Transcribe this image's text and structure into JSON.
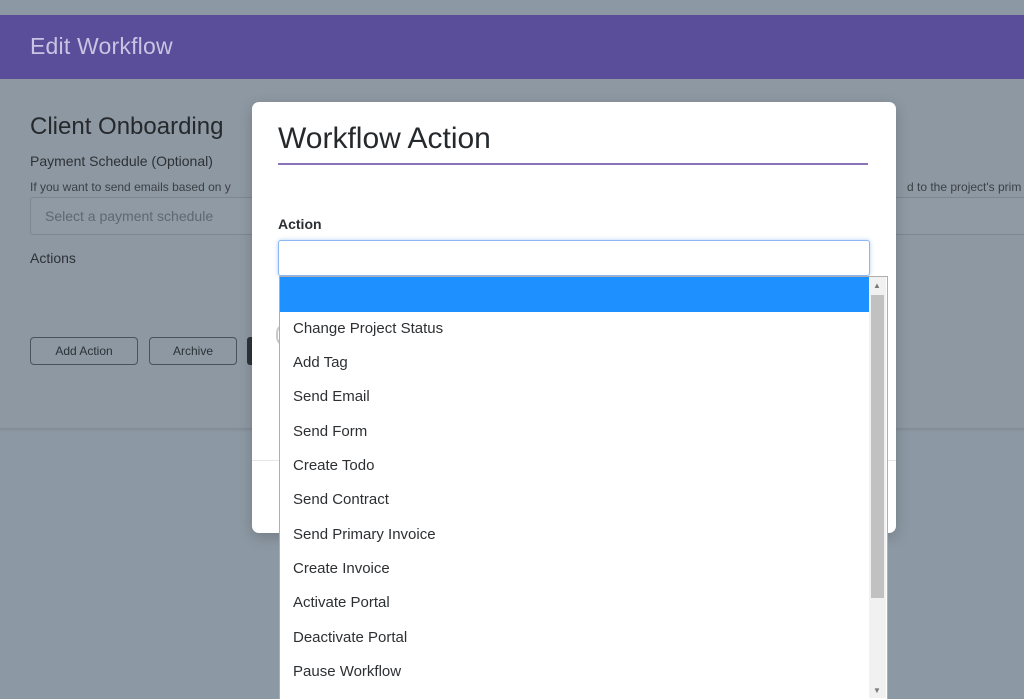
{
  "header": {
    "title": "Edit Workflow"
  },
  "background": {
    "workflow_name": "Client Onboarding",
    "payment_schedule_label": "Payment Schedule (Optional)",
    "payment_help_left": "If you want to send emails based on y",
    "payment_help_right": "d to the project's prim",
    "payment_placeholder": "Select a payment schedule",
    "actions_label": "Actions",
    "add_action_label": "Add Action",
    "archive_label": "Archive"
  },
  "modal": {
    "title": "Workflow Action",
    "action_label": "Action",
    "select_value": "",
    "options": [
      "",
      "Change Project Status",
      "Add Tag",
      "Send Email",
      "Send Form",
      "Create Todo",
      "Send Contract",
      "Send Primary Invoice",
      "Create Invoice",
      "Activate Portal",
      "Deactivate Portal",
      "Pause Workflow"
    ],
    "highlighted_index": 0
  },
  "colors": {
    "header_bg": "#5a4d99",
    "title_rule": "#8a73b8",
    "highlight": "#1e90ff"
  }
}
